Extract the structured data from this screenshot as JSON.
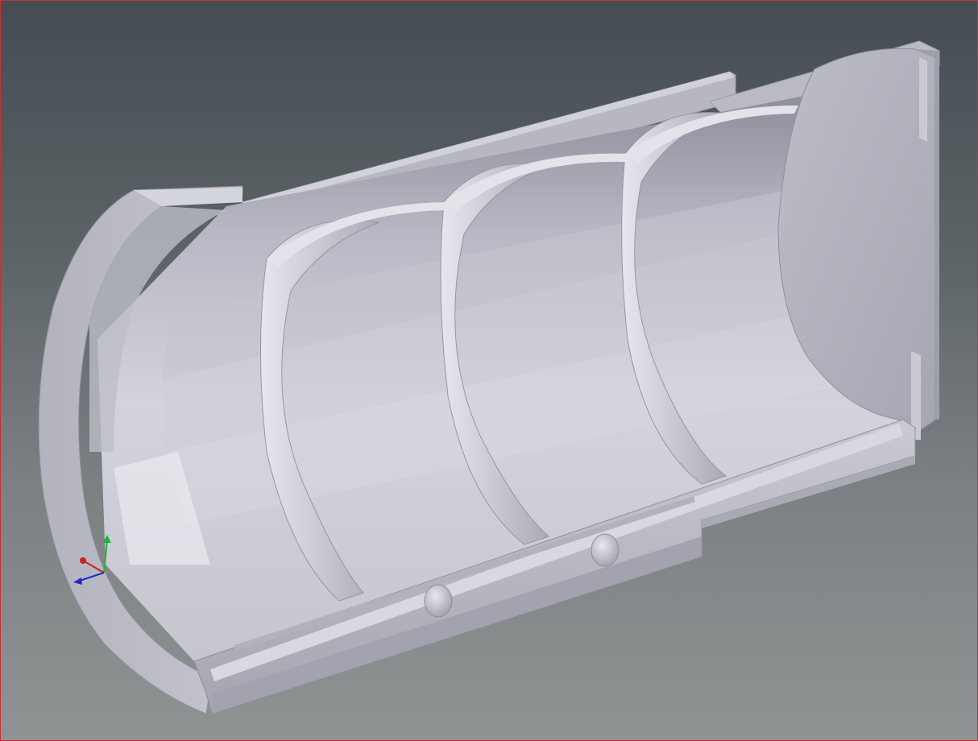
{
  "viewport": {
    "background_top": "#454d53",
    "background_bottom": "#8f9393",
    "border_color": "#c8303a"
  },
  "model": {
    "type": "half-cylindrical ribbed shell (CAD part)",
    "surface_color": "#c2c3cd",
    "rib_count": 4,
    "boss_count": 2
  },
  "axis_triad": {
    "x_axis_color": "#cc2020",
    "y_axis_color": "#20b040",
    "z_axis_color": "#1c2cc8"
  }
}
